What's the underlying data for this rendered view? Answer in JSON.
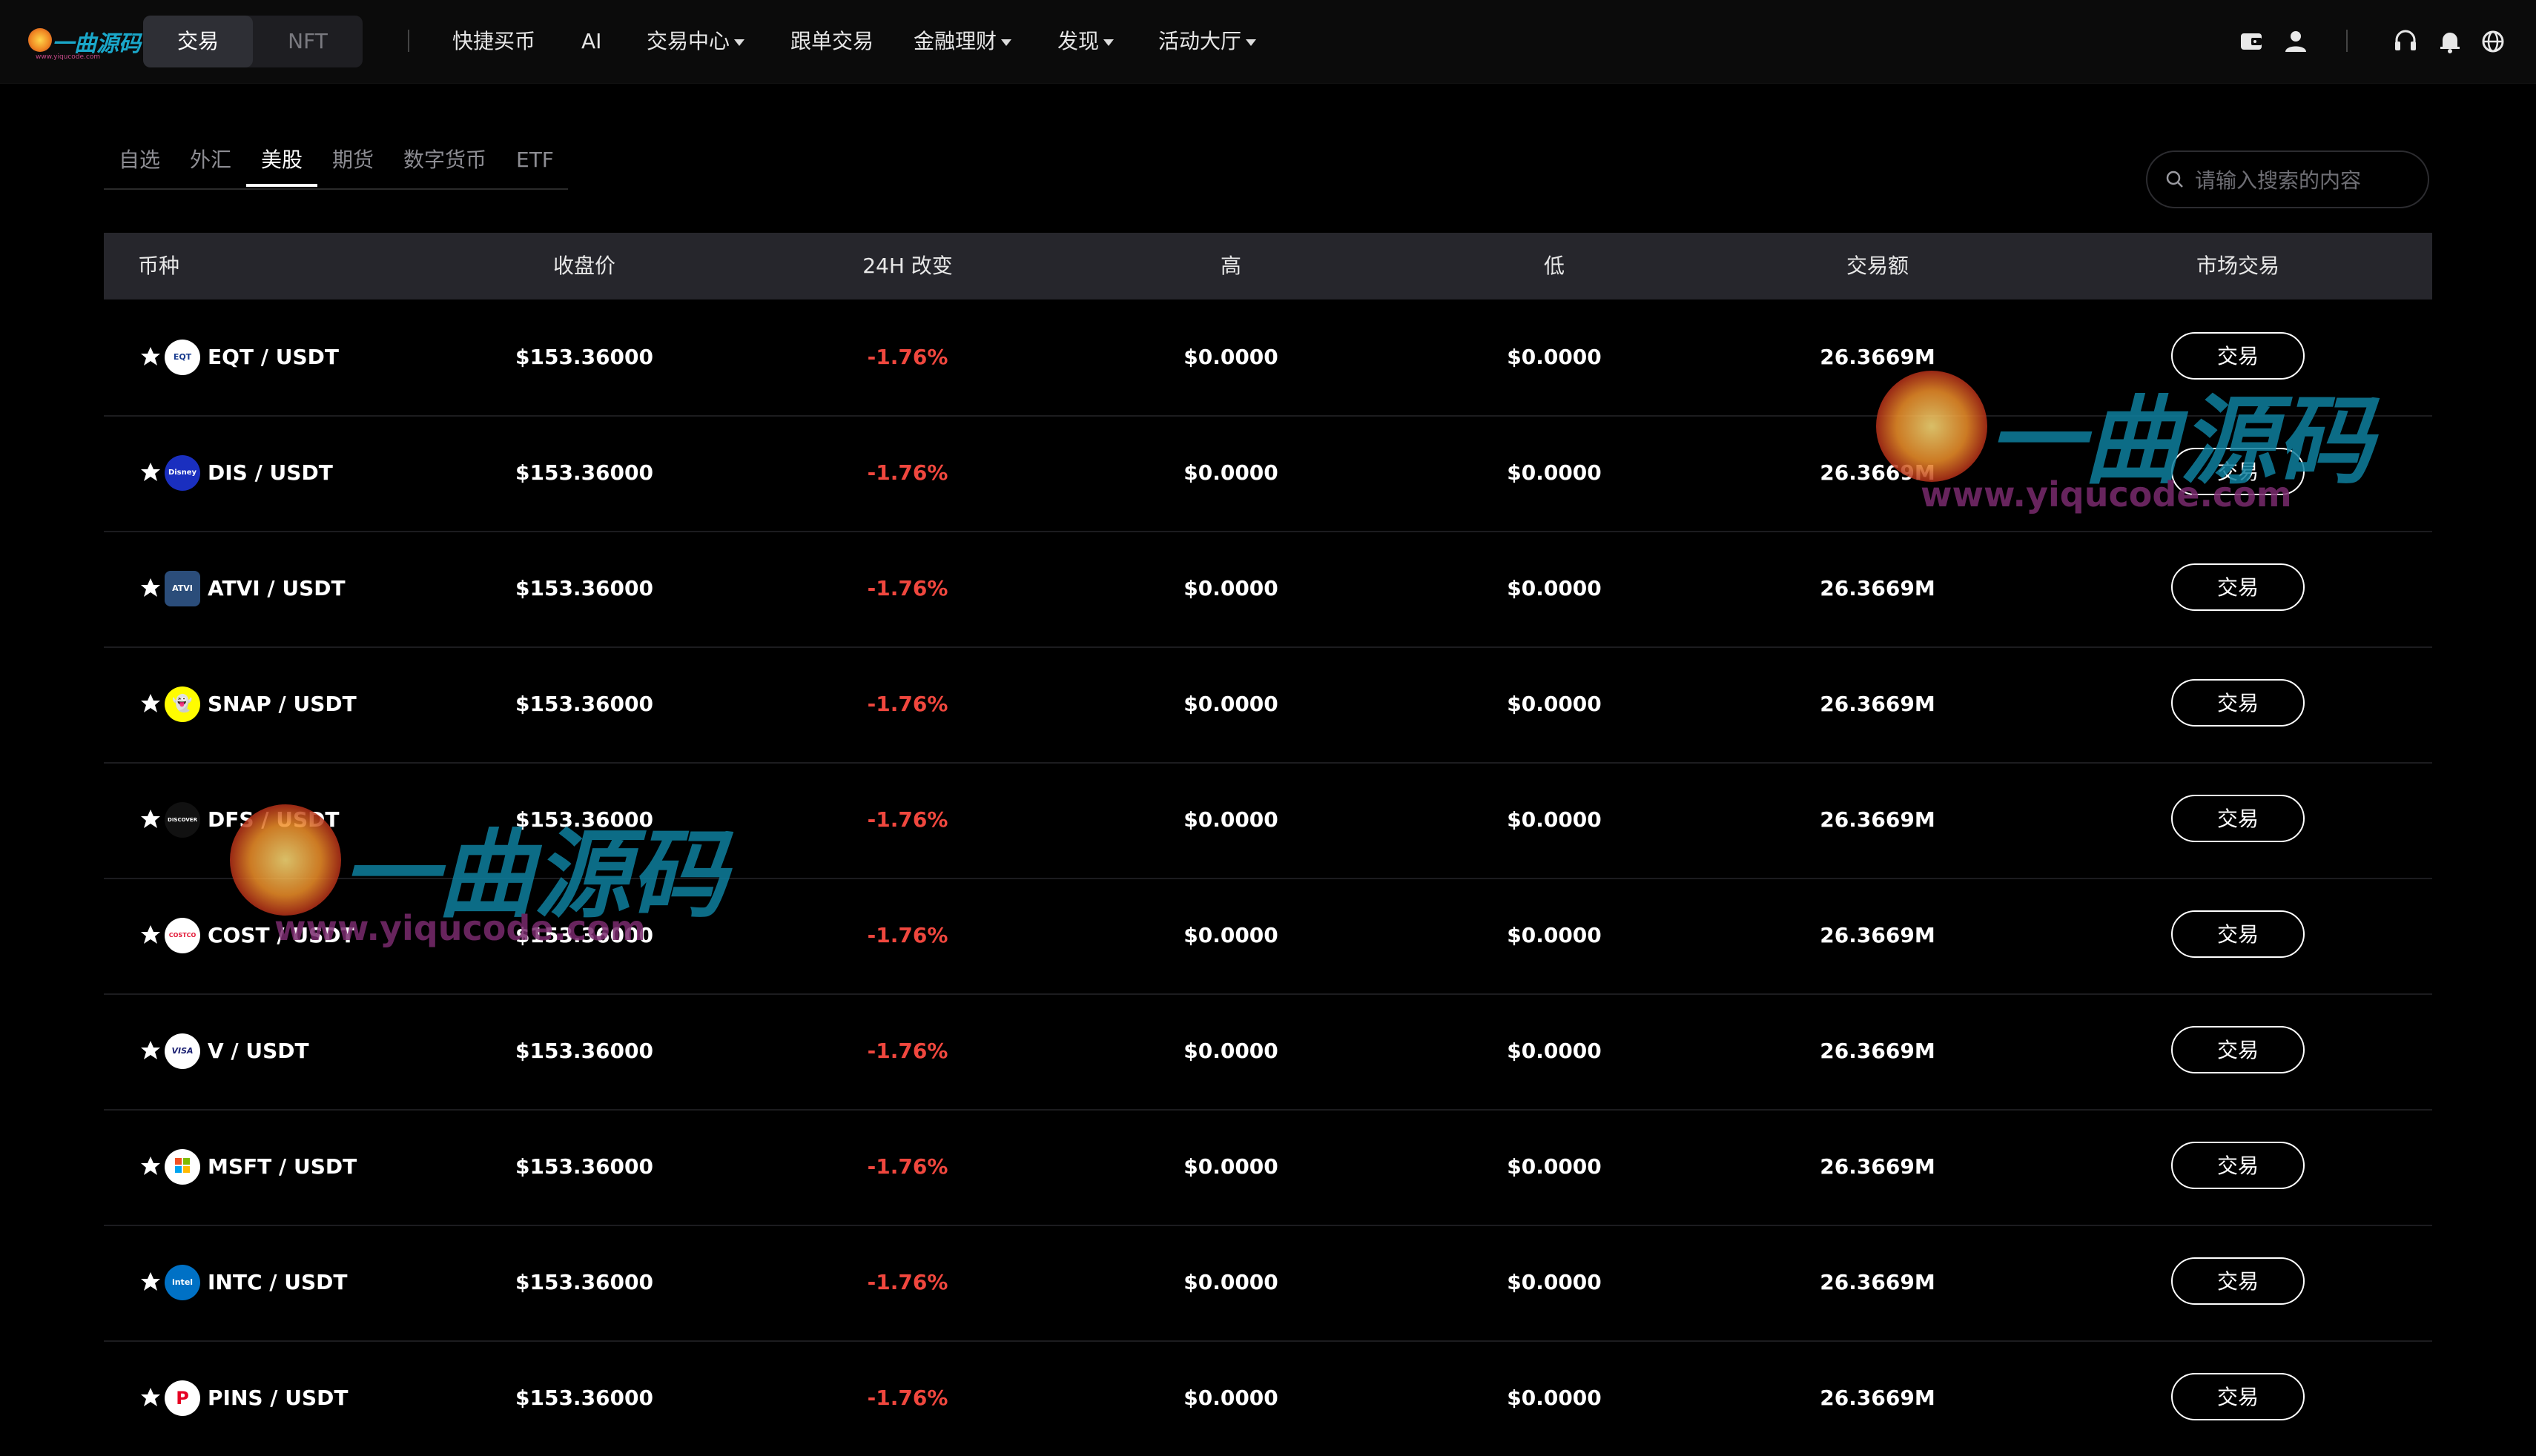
{
  "logo": {
    "brand": "一曲源码",
    "url": "www.yiqucode.com"
  },
  "header": {
    "segments": [
      "交易",
      "NFT"
    ],
    "nav": [
      {
        "label": "快捷买币",
        "dropdown": false
      },
      {
        "label": "AI",
        "dropdown": false
      },
      {
        "label": "交易中心",
        "dropdown": true
      },
      {
        "label": "跟单交易",
        "dropdown": false
      },
      {
        "label": "金融理财",
        "dropdown": true
      },
      {
        "label": "发现",
        "dropdown": true
      },
      {
        "label": "活动大厅",
        "dropdown": true
      }
    ],
    "icons": [
      "wallet-icon",
      "user-icon",
      "headset-icon",
      "bell-icon",
      "globe-icon"
    ]
  },
  "tabs": [
    "自选",
    "外汇",
    "美股",
    "期货",
    "数字货币",
    "ETF"
  ],
  "active_tab": "美股",
  "search": {
    "placeholder": "请输入搜索的内容",
    "value": ""
  },
  "table": {
    "columns": [
      "币种",
      "收盘价",
      "24H 改变",
      "高",
      "低",
      "交易额",
      "市场交易"
    ],
    "rows": [
      {
        "pair": "EQT / USDT",
        "icon_text": "EQT",
        "price": "$153.36000",
        "change": "-1.76%",
        "high": "$0.0000",
        "low": "$0.0000",
        "volume": "26.3669M",
        "action": "交易"
      },
      {
        "pair": "DIS / USDT",
        "icon_text": "Disney",
        "price": "$153.36000",
        "change": "-1.76%",
        "high": "$0.0000",
        "low": "$0.0000",
        "volume": "26.3669M",
        "action": "交易"
      },
      {
        "pair": "ATVI / USDT",
        "icon_text": "ATVI",
        "price": "$153.36000",
        "change": "-1.76%",
        "high": "$0.0000",
        "low": "$0.0000",
        "volume": "26.3669M",
        "action": "交易"
      },
      {
        "pair": "SNAP / USDT",
        "icon_text": "👻",
        "price": "$153.36000",
        "change": "-1.76%",
        "high": "$0.0000",
        "low": "$0.0000",
        "volume": "26.3669M",
        "action": "交易"
      },
      {
        "pair": "DFS / USDT",
        "icon_text": "DISCOVER",
        "price": "$153.36000",
        "change": "-1.76%",
        "high": "$0.0000",
        "low": "$0.0000",
        "volume": "26.3669M",
        "action": "交易"
      },
      {
        "pair": "COST / USDT",
        "icon_text": "COSTCO",
        "price": "$153.36000",
        "change": "-1.76%",
        "high": "$0.0000",
        "low": "$0.0000",
        "volume": "26.3669M",
        "action": "交易"
      },
      {
        "pair": "V / USDT",
        "icon_text": "VISA",
        "price": "$153.36000",
        "change": "-1.76%",
        "high": "$0.0000",
        "low": "$0.0000",
        "volume": "26.3669M",
        "action": "交易"
      },
      {
        "pair": "MSFT / USDT",
        "icon_text": "MS",
        "price": "$153.36000",
        "change": "-1.76%",
        "high": "$0.0000",
        "low": "$0.0000",
        "volume": "26.3669M",
        "action": "交易"
      },
      {
        "pair": "INTC / USDT",
        "icon_text": "intel",
        "price": "$153.36000",
        "change": "-1.76%",
        "high": "$0.0000",
        "low": "$0.0000",
        "volume": "26.3669M",
        "action": "交易"
      },
      {
        "pair": "PINS / USDT",
        "icon_text": "P",
        "price": "$153.36000",
        "change": "-1.76%",
        "high": "$0.0000",
        "low": "$0.0000",
        "volume": "26.3669M",
        "action": "交易"
      }
    ]
  },
  "watermark": {
    "text": "一曲源码",
    "url": "www.yiqucode.com"
  },
  "colors": {
    "negative": "#f0473e",
    "header_bg": "#26262c",
    "page_bg": "#000000"
  }
}
